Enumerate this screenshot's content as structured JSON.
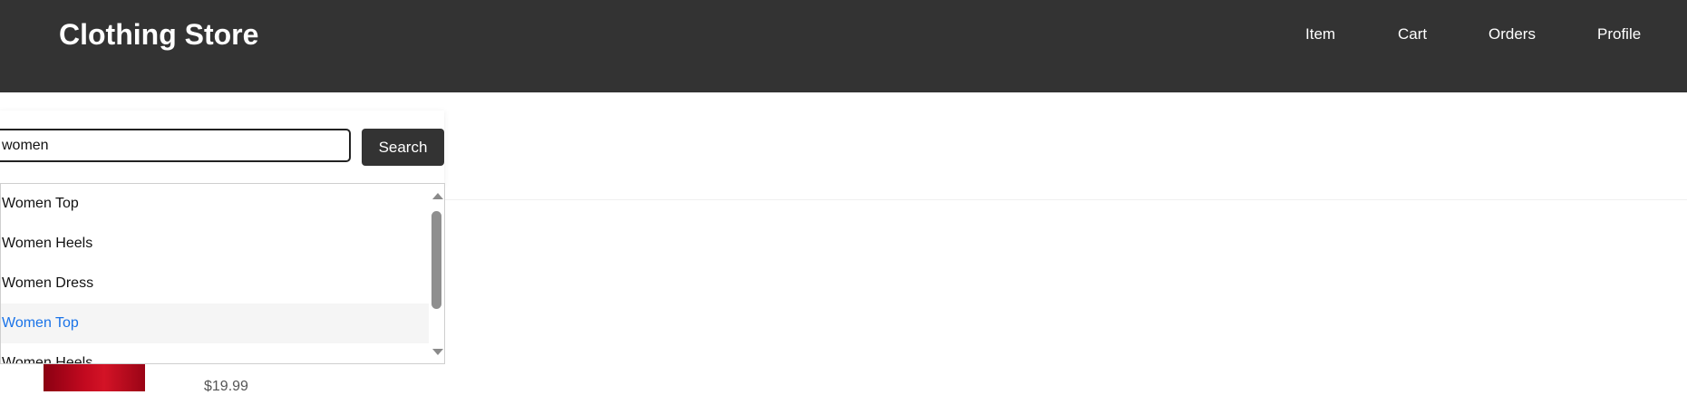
{
  "header": {
    "brand": "Clothing Store",
    "nav": [
      "Item",
      "Cart",
      "Orders",
      "Profile"
    ]
  },
  "search": {
    "value": "women",
    "placeholder": "",
    "button_label": "Search"
  },
  "suggestions": [
    "Women Top",
    "Women Heels",
    "Women Dress",
    "Women Top",
    "Women Heels"
  ],
  "highlighted_suggestion_index": 3,
  "product": {
    "price": "$19.99"
  },
  "colors": {
    "header_bg": "#333333",
    "button_bg": "#333333",
    "highlight_text": "#1a73e8"
  }
}
